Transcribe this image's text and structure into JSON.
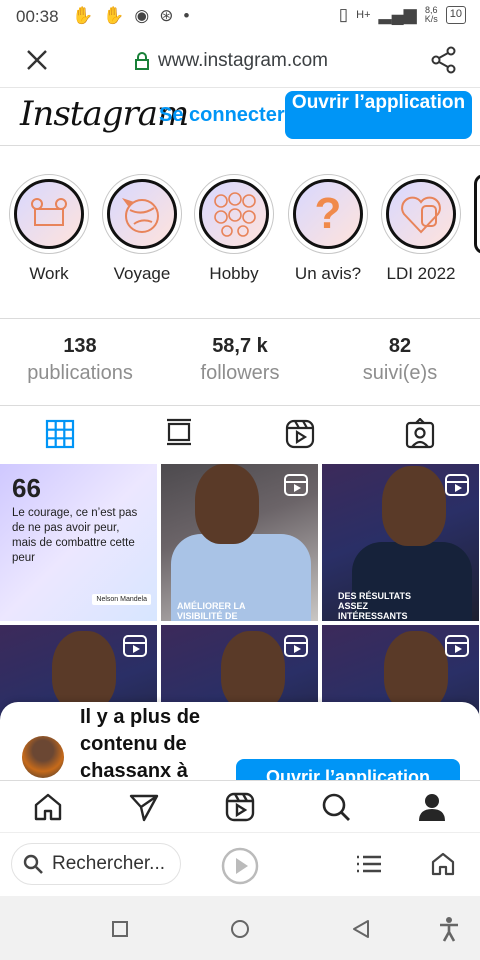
{
  "status": {
    "time": "00:38",
    "net_speed": "8,6",
    "net_unit": "K/s",
    "battery": "10",
    "network": "H+"
  },
  "browser": {
    "url": "www.instagram.com",
    "search_placeholder": "Rechercher..."
  },
  "header": {
    "logo": "Instagram",
    "connect": "Se connecter",
    "open_app": "Ouvrir l’application"
  },
  "highlights": [
    {
      "label": "Work",
      "icon": "desk-icon"
    },
    {
      "label": "Voyage",
      "icon": "globe-plane-icon"
    },
    {
      "label": "Hobby",
      "icon": "sports-balls-icon"
    },
    {
      "label": "Un avis?",
      "icon": "question-icon"
    },
    {
      "label": "LDI 2022",
      "icon": "heart-hand-icon"
    }
  ],
  "stats": [
    {
      "value": "138",
      "label": "publications"
    },
    {
      "value": "58,7 k",
      "label": "followers"
    },
    {
      "value": "82",
      "label": "suivi(e)s"
    }
  ],
  "grid": {
    "quote_mark": "66",
    "quote_text": "Le courage, ce n’est pas de ne pas avoir peur, mais de combattre cette peur",
    "quote_author": "Nelson Mandela",
    "caption_2": "AMÉLIORER LA VISIBILITÉ DE",
    "caption_3": "DES RÉSULTATS ASSEZ INTÉRESSANTS"
  },
  "sheet": {
    "message": "Il y a plus de contenu de chassanx à",
    "button": "Ouvrir l’application"
  },
  "colors": {
    "accent": "#0095f6",
    "text": "#262626",
    "muted": "#8e8e8e"
  }
}
